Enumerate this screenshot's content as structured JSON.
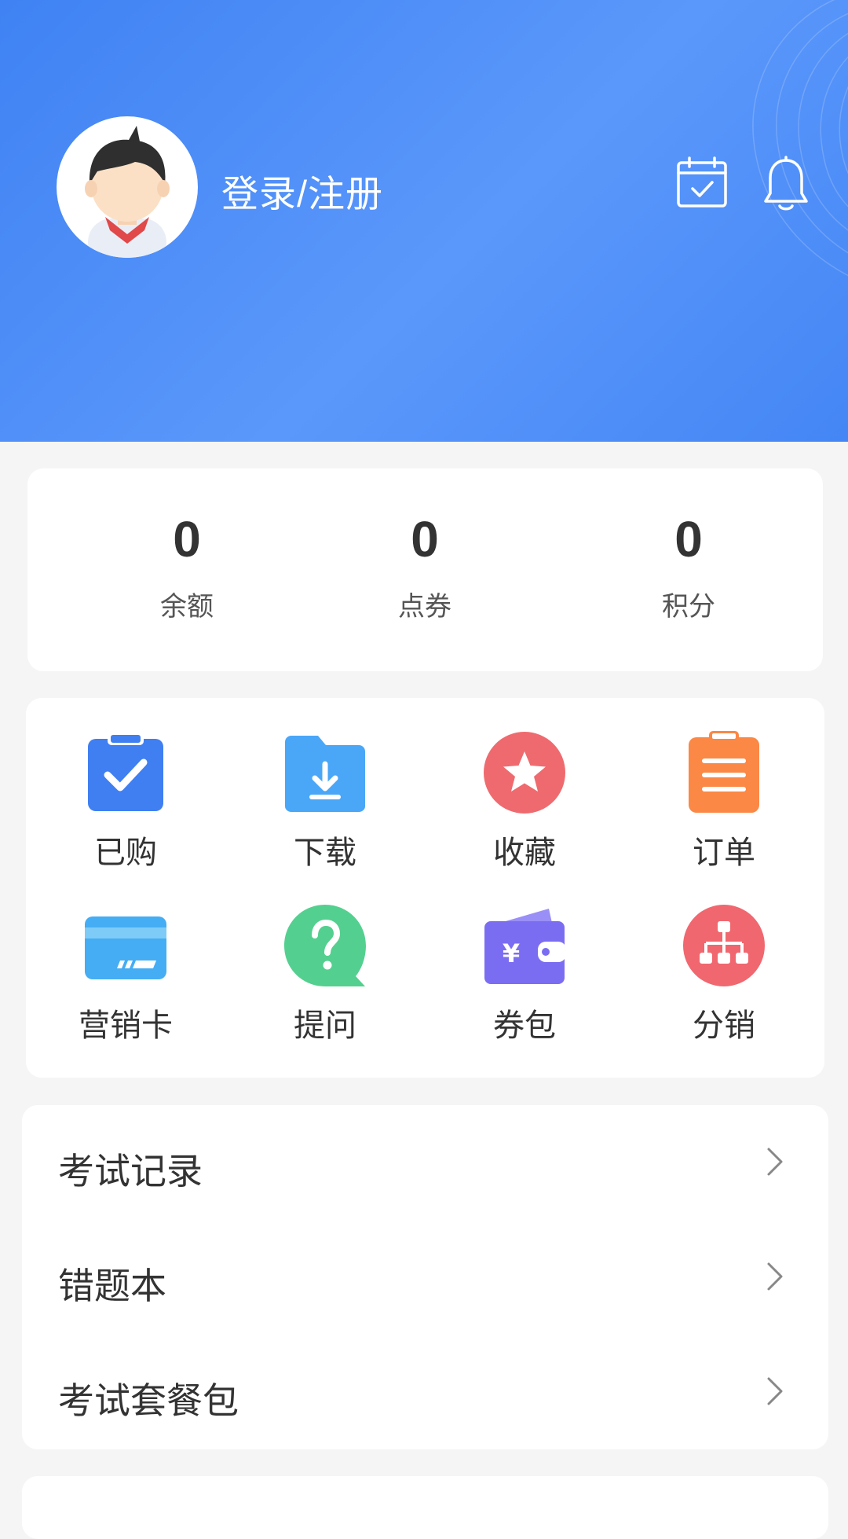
{
  "header": {
    "login_label": "登录/注册",
    "icons": [
      "avatar",
      "calendar-check-icon",
      "bell-icon"
    ]
  },
  "stats": [
    {
      "value": "0",
      "label": "余额"
    },
    {
      "value": "0",
      "label": "点券"
    },
    {
      "value": "0",
      "label": "积分"
    }
  ],
  "grid": [
    {
      "label": "已购",
      "icon": "clipboard-check-icon",
      "color": "#3f7ff2"
    },
    {
      "label": "下载",
      "icon": "folder-download-icon",
      "color": "#4aa7f8"
    },
    {
      "label": "收藏",
      "icon": "star-icon",
      "color": "#ef6a6e"
    },
    {
      "label": "订单",
      "icon": "order-list-icon",
      "color": "#fb8845"
    },
    {
      "label": "营销卡",
      "icon": "card-icon",
      "color": "#45adf3"
    },
    {
      "label": "提问",
      "icon": "question-icon",
      "color": "#53d08f"
    },
    {
      "label": "券包",
      "icon": "wallet-icon",
      "color": "#7b6df2"
    },
    {
      "label": "分销",
      "icon": "distribution-icon",
      "color": "#f0676f"
    }
  ],
  "menu": [
    {
      "label": "考试记录"
    },
    {
      "label": "错题本"
    },
    {
      "label": "考试套餐包"
    }
  ],
  "colors": {
    "header_start": "#3f82f3",
    "header_end": "#5b98fb",
    "page_bg": "#f5f5f5"
  }
}
